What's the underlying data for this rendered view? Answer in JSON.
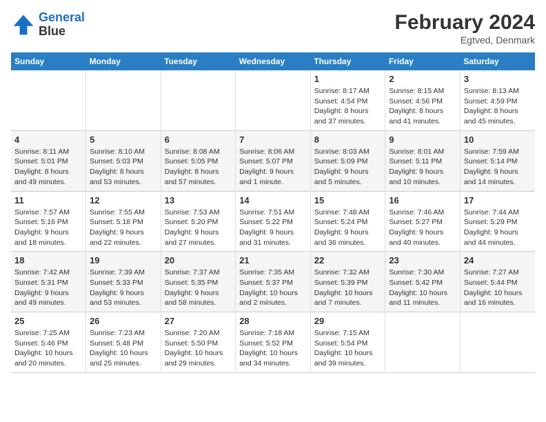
{
  "logo": {
    "line1": "General",
    "line2": "Blue"
  },
  "title": "February 2024",
  "subtitle": "Egtved, Denmark",
  "days_of_week": [
    "Sunday",
    "Monday",
    "Tuesday",
    "Wednesday",
    "Thursday",
    "Friday",
    "Saturday"
  ],
  "weeks": [
    [
      {
        "day": "",
        "detail": ""
      },
      {
        "day": "",
        "detail": ""
      },
      {
        "day": "",
        "detail": ""
      },
      {
        "day": "",
        "detail": ""
      },
      {
        "day": "1",
        "detail": "Sunrise: 8:17 AM\nSunset: 4:54 PM\nDaylight: 8 hours\nand 37 minutes."
      },
      {
        "day": "2",
        "detail": "Sunrise: 8:15 AM\nSunset: 4:56 PM\nDaylight: 8 hours\nand 41 minutes."
      },
      {
        "day": "3",
        "detail": "Sunrise: 8:13 AM\nSunset: 4:59 PM\nDaylight: 8 hours\nand 45 minutes."
      }
    ],
    [
      {
        "day": "4",
        "detail": "Sunrise: 8:11 AM\nSunset: 5:01 PM\nDaylight: 8 hours\nand 49 minutes."
      },
      {
        "day": "5",
        "detail": "Sunrise: 8:10 AM\nSunset: 5:03 PM\nDaylight: 8 hours\nand 53 minutes."
      },
      {
        "day": "6",
        "detail": "Sunrise: 8:08 AM\nSunset: 5:05 PM\nDaylight: 8 hours\nand 57 minutes."
      },
      {
        "day": "7",
        "detail": "Sunrise: 8:06 AM\nSunset: 5:07 PM\nDaylight: 9 hours\nand 1 minute."
      },
      {
        "day": "8",
        "detail": "Sunrise: 8:03 AM\nSunset: 5:09 PM\nDaylight: 9 hours\nand 5 minutes."
      },
      {
        "day": "9",
        "detail": "Sunrise: 8:01 AM\nSunset: 5:11 PM\nDaylight: 9 hours\nand 10 minutes."
      },
      {
        "day": "10",
        "detail": "Sunrise: 7:59 AM\nSunset: 5:14 PM\nDaylight: 9 hours\nand 14 minutes."
      }
    ],
    [
      {
        "day": "11",
        "detail": "Sunrise: 7:57 AM\nSunset: 5:16 PM\nDaylight: 9 hours\nand 18 minutes."
      },
      {
        "day": "12",
        "detail": "Sunrise: 7:55 AM\nSunset: 5:18 PM\nDaylight: 9 hours\nand 22 minutes."
      },
      {
        "day": "13",
        "detail": "Sunrise: 7:53 AM\nSunset: 5:20 PM\nDaylight: 9 hours\nand 27 minutes."
      },
      {
        "day": "14",
        "detail": "Sunrise: 7:51 AM\nSunset: 5:22 PM\nDaylight: 9 hours\nand 31 minutes."
      },
      {
        "day": "15",
        "detail": "Sunrise: 7:48 AM\nSunset: 5:24 PM\nDaylight: 9 hours\nand 36 minutes."
      },
      {
        "day": "16",
        "detail": "Sunrise: 7:46 AM\nSunset: 5:27 PM\nDaylight: 9 hours\nand 40 minutes."
      },
      {
        "day": "17",
        "detail": "Sunrise: 7:44 AM\nSunset: 5:29 PM\nDaylight: 9 hours\nand 44 minutes."
      }
    ],
    [
      {
        "day": "18",
        "detail": "Sunrise: 7:42 AM\nSunset: 5:31 PM\nDaylight: 9 hours\nand 49 minutes."
      },
      {
        "day": "19",
        "detail": "Sunrise: 7:39 AM\nSunset: 5:33 PM\nDaylight: 9 hours\nand 53 minutes."
      },
      {
        "day": "20",
        "detail": "Sunrise: 7:37 AM\nSunset: 5:35 PM\nDaylight: 9 hours\nand 58 minutes."
      },
      {
        "day": "21",
        "detail": "Sunrise: 7:35 AM\nSunset: 5:37 PM\nDaylight: 10 hours\nand 2 minutes."
      },
      {
        "day": "22",
        "detail": "Sunrise: 7:32 AM\nSunset: 5:39 PM\nDaylight: 10 hours\nand 7 minutes."
      },
      {
        "day": "23",
        "detail": "Sunrise: 7:30 AM\nSunset: 5:42 PM\nDaylight: 10 hours\nand 11 minutes."
      },
      {
        "day": "24",
        "detail": "Sunrise: 7:27 AM\nSunset: 5:44 PM\nDaylight: 10 hours\nand 16 minutes."
      }
    ],
    [
      {
        "day": "25",
        "detail": "Sunrise: 7:25 AM\nSunset: 5:46 PM\nDaylight: 10 hours\nand 20 minutes."
      },
      {
        "day": "26",
        "detail": "Sunrise: 7:23 AM\nSunset: 5:48 PM\nDaylight: 10 hours\nand 25 minutes."
      },
      {
        "day": "27",
        "detail": "Sunrise: 7:20 AM\nSunset: 5:50 PM\nDaylight: 10 hours\nand 29 minutes."
      },
      {
        "day": "28",
        "detail": "Sunrise: 7:18 AM\nSunset: 5:52 PM\nDaylight: 10 hours\nand 34 minutes."
      },
      {
        "day": "29",
        "detail": "Sunrise: 7:15 AM\nSunset: 5:54 PM\nDaylight: 10 hours\nand 39 minutes."
      },
      {
        "day": "",
        "detail": ""
      },
      {
        "day": "",
        "detail": ""
      }
    ]
  ]
}
